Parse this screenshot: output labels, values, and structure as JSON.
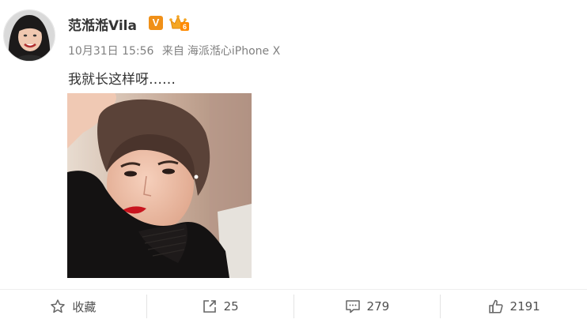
{
  "author": {
    "name": "范湉湉Vila",
    "vip_label": "V",
    "verified_color": "#f09018",
    "crown_level": "6",
    "avatar": "avatar-photo"
  },
  "post": {
    "date": "10月31日",
    "time": "15:56",
    "source_prefix": "来自",
    "source": "海派湉心iPhone X",
    "text": "我就长这样呀……",
    "image": "selfie-photo"
  },
  "actions": {
    "favorite_label": "收藏",
    "repost_count": "25",
    "comment_count": "279",
    "like_count": "2191"
  },
  "icons": {
    "favorite": "star-icon",
    "repost": "share-icon",
    "comment": "comment-icon",
    "like": "thumbs-up-icon"
  }
}
